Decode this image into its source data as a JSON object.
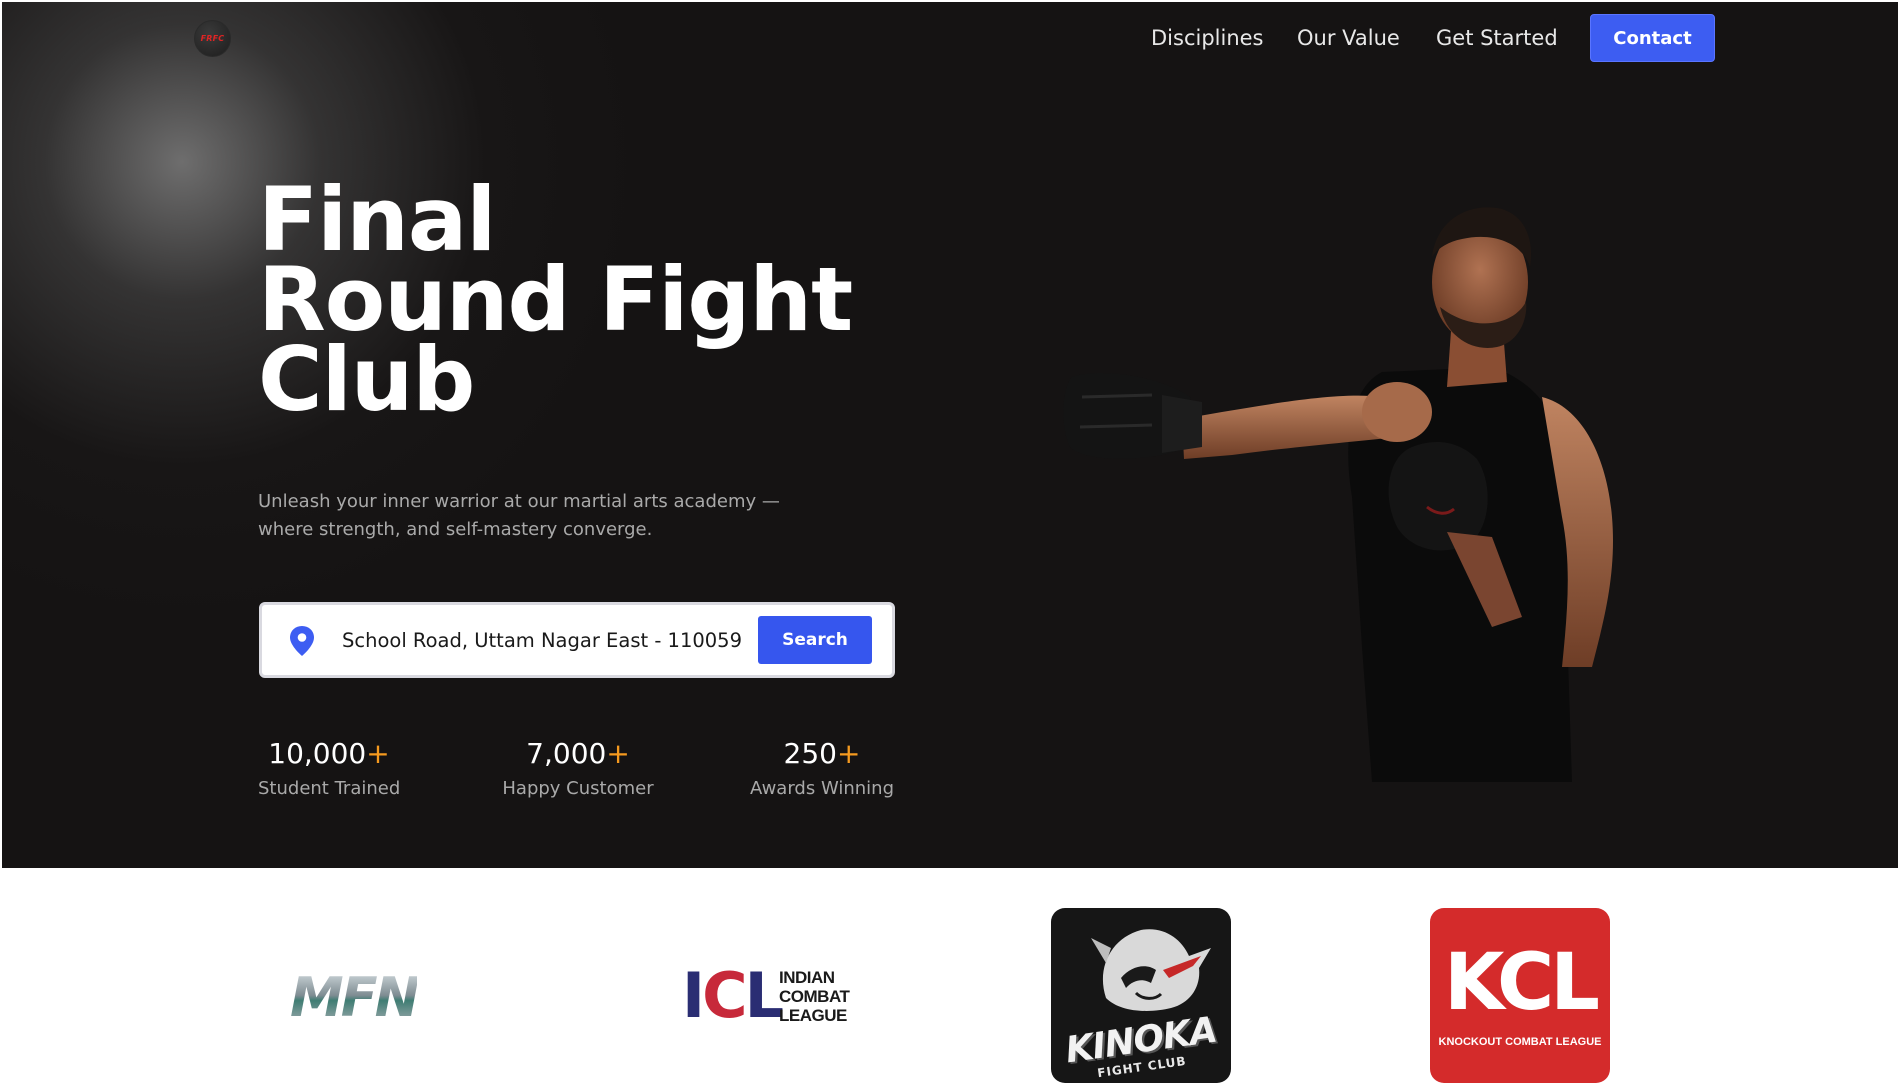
{
  "brand": {
    "logo_text": "FRFC"
  },
  "nav": {
    "links": [
      "Disciplines",
      "Our Value",
      "Get Started"
    ],
    "contact_label": "Contact"
  },
  "hero": {
    "title_lines": [
      "Final",
      "Round Fight",
      "Club"
    ],
    "subtitle_lines": [
      "Unleash your inner warrior at our martial arts academy —",
      "where strength, and self-mastery converge."
    ],
    "search": {
      "value": "School Road, Uttam Nagar East - 110059",
      "button_label": "Search",
      "icon": "map-pin-icon"
    },
    "stats": [
      {
        "value": "10,000",
        "suffix": "+",
        "label": "Student Trained"
      },
      {
        "value": "7,000",
        "suffix": "+",
        "label": "Happy Customer"
      },
      {
        "value": "250",
        "suffix": "+",
        "label": "Awards Winning"
      }
    ]
  },
  "partners": {
    "mfn": {
      "text": "MFN"
    },
    "icl": {
      "letters": [
        "I",
        "C",
        "L"
      ],
      "words": [
        "INDIAN",
        "COMBAT",
        "LEAGUE"
      ]
    },
    "kinoka": {
      "title": "KINOKA",
      "subtitle": "FIGHT CLUB"
    },
    "kcl": {
      "letters": "KCL",
      "subtitle": "KNOCKOUT COMBAT LEAGUE"
    }
  },
  "colors": {
    "hero_bg": "#151313",
    "accent_blue": "#3d5df2",
    "stat_plus": "#f59a1f",
    "kcl_red": "#d42b2b"
  }
}
